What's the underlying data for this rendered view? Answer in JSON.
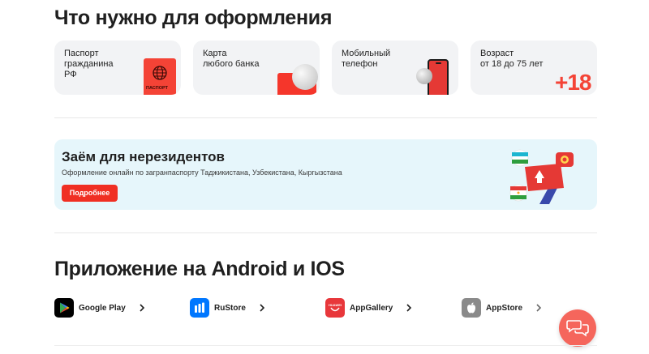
{
  "requirements": {
    "title": "Что нужно для оформления",
    "cards": [
      {
        "label": "Паспорт\nгражданина\nРФ",
        "image_text": "ПАСПОРТ"
      },
      {
        "label": "Карта\nлюбого банка"
      },
      {
        "label": "Мобильный\nтелефон"
      },
      {
        "label": "Возраст\nот 18 до 75 лет",
        "badge": "+18"
      }
    ]
  },
  "banner": {
    "title": "Заём для нерезидентов",
    "subtitle": "Оформление онлайн по загранпаспорту Таджикистана, Узбекистана, Кыргызстана",
    "button": "Подробнее"
  },
  "apps": {
    "title": "Приложение на Android и IOS",
    "stores": [
      {
        "label": "Google Play",
        "icon": "google-play-icon"
      },
      {
        "label": "RuStore",
        "icon": "rustore-icon"
      },
      {
        "label": "AppGallery",
        "icon": "appgallery-icon",
        "icon_text": "HUAWEI"
      },
      {
        "label": "AppStore",
        "icon": "apple-icon"
      }
    ]
  },
  "colors": {
    "accent": "#f44336",
    "banner_bg": "#e6f6fb",
    "card_bg": "#f2f3f5",
    "chat": "#f5665c"
  }
}
